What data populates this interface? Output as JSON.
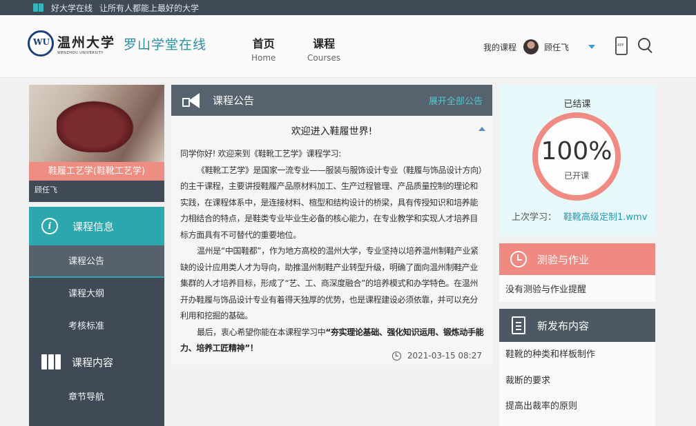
{
  "topbar": {
    "site": "好大学在线",
    "slogan": "让所有人都能上最好的大学"
  },
  "header": {
    "university_cn": "温州大学",
    "university_en": "WENZHOU UNIVERSITY",
    "platform": "罗山学堂在线",
    "nav": [
      {
        "zh": "首页",
        "en": "Home"
      },
      {
        "zh": "课程",
        "en": "Courses"
      }
    ],
    "my_courses": "我的课程",
    "username": "顾任飞"
  },
  "course": {
    "title": "鞋履工艺学(鞋靴工艺学)",
    "teacher": "顾任飞"
  },
  "sidebar": {
    "info_title": "课程信息",
    "info_items": [
      "课程公告",
      "课程大纲",
      "考核标准"
    ],
    "content_title": "课程内容",
    "content_items": [
      "章节导航"
    ]
  },
  "notice": {
    "header": "课程公告",
    "expand_all": "展开全部公告",
    "title": "欢迎进入鞋履世界!",
    "greeting": "同学你好! 欢迎来到《鞋靴工艺学》课程学习:",
    "p1": "《鞋靴工艺学》是国家一流专业——服装与服饰设计专业（鞋履与饰品设计方向）的主干课程，主要讲授鞋履产品原材料加工、生产过程管理、产品质量控制的理论和实践，在课程体系中，是连接材料、楦型和结构设计的桥梁，具有传授知识和培养能力相结合的特点，是鞋类专业毕业生必备的核心能力，在专业教学和实现人才培养目标方面具有不可替代的重要地位。",
    "p2": "温州是“中国鞋都”，作为地方高校的温州大学，专业坚持以培养温州制鞋产业紧缺的设计应用类人才为导向，助推温州制鞋产业转型升级，明确了面向温州制鞋产业集群的人才培养目标，形成了“艺、工、商深度融合”的培养模式和办学特色。在温州开办鞋履与饰品设计专业有着得天独厚的优势，也是课程建设必须依靠，并可以充分利用和挖掘的基础。",
    "p3_prefix": "最后，衷心希望你能在本课程学习中",
    "p3_bold": "“夯实理论基础、强化知识运用、锻炼动手能力、培养工匠精神”！",
    "date": "2021-03-15 08:27"
  },
  "status": {
    "state": "已结课",
    "percent": "100%",
    "progress": 1.0,
    "sub": "已开课",
    "last_label": "上次学习：",
    "last_file": "鞋靴高级定制1.wmv"
  },
  "quiz": {
    "title": "测验与作业",
    "empty": "没有测验与作业提醒"
  },
  "news": {
    "title": "新发布内容",
    "items": [
      "鞋靴的种类和样板制作",
      "裁断的要求",
      "提高出裁率的原则"
    ]
  },
  "colors": {
    "teal": "#2ca7ad",
    "coral": "#ef8a83",
    "slate": "#3f4a56",
    "link": "#2797b5"
  }
}
